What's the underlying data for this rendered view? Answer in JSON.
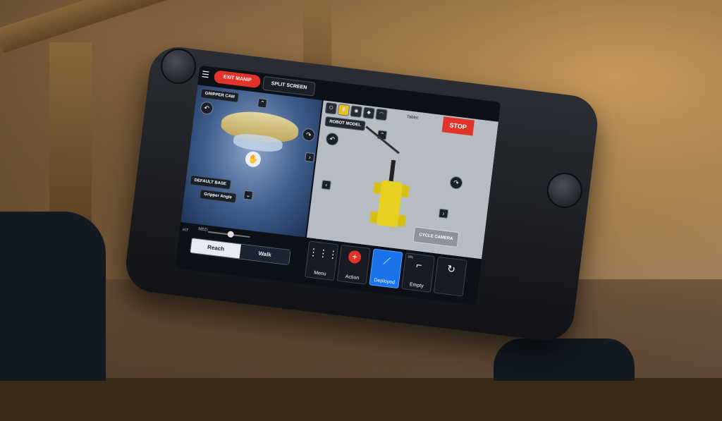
{
  "photo": {
    "description_icons": [
      "left-joystick",
      "right-joystick"
    ]
  },
  "app": {
    "topbar": {
      "exit_label": "EXIT MANIP",
      "split_label": "SPLIT SCREEN"
    },
    "left_pane": {
      "camera_label": "GRIPPER CAM",
      "default_label": "DEFAULT BASE",
      "gripper_label": "Gripper Angle"
    },
    "right_pane": {
      "model_label": "ROBOT MODEL",
      "tablet_label": "Tablet",
      "stop_label": "STOP",
      "cycle_label": "CYCLE CAMERA"
    },
    "bottom_left": {
      "ht_label": "HT",
      "med_label": "MED",
      "speed_level": 0.5,
      "mode_options": [
        "Reach",
        "Walk"
      ],
      "mode_selected": "Reach"
    },
    "toolbar": [
      {
        "label": "Menu",
        "icon": "grid-icon",
        "active": false
      },
      {
        "label": "Action",
        "icon": "plus-icon",
        "active": false
      },
      {
        "label": "Deployed",
        "icon": "arm-icon",
        "active": true
      },
      {
        "label": "Empty",
        "icon": "gripper-icon",
        "active": false,
        "percent": "0%"
      },
      {
        "label": "",
        "icon": "refresh-icon",
        "active": false
      }
    ],
    "colors": {
      "stop": "#e0342a",
      "active_tool": "#1a73e8",
      "robot": "#e8d020"
    }
  }
}
